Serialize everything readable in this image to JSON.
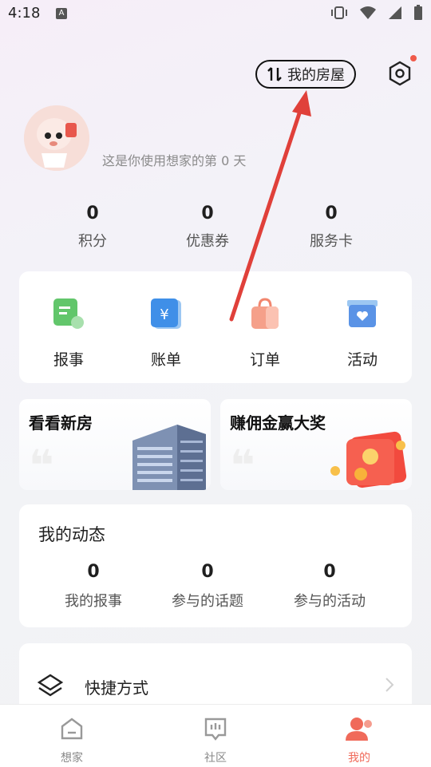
{
  "status_bar": {
    "time": "4:18",
    "badge": "A"
  },
  "header": {
    "house_button": "我的房屋"
  },
  "profile": {
    "days_text": "这是你使用想家的第 0 天"
  },
  "stats": [
    {
      "value": "0",
      "label": "积分"
    },
    {
      "value": "0",
      "label": "优惠券"
    },
    {
      "value": "0",
      "label": "服务卡"
    }
  ],
  "shortcuts": [
    {
      "label": "报事",
      "icon": "report-icon"
    },
    {
      "label": "账单",
      "icon": "bill-icon"
    },
    {
      "label": "订单",
      "icon": "order-icon"
    },
    {
      "label": "活动",
      "icon": "activity-icon"
    }
  ],
  "promos": [
    {
      "title": "看看新房"
    },
    {
      "title": "赚佣金赢大奖"
    }
  ],
  "my_activity": {
    "title": "我的动态",
    "items": [
      {
        "value": "0",
        "label": "我的报事"
      },
      {
        "value": "0",
        "label": "参与的话题"
      },
      {
        "value": "0",
        "label": "参与的活动"
      }
    ]
  },
  "quick": {
    "label": "快捷方式"
  },
  "tabs": [
    {
      "label": "想家"
    },
    {
      "label": "社区"
    },
    {
      "label": "我的"
    }
  ],
  "colors": {
    "accent": "#f06a5a",
    "arrow": "#e0403a"
  }
}
